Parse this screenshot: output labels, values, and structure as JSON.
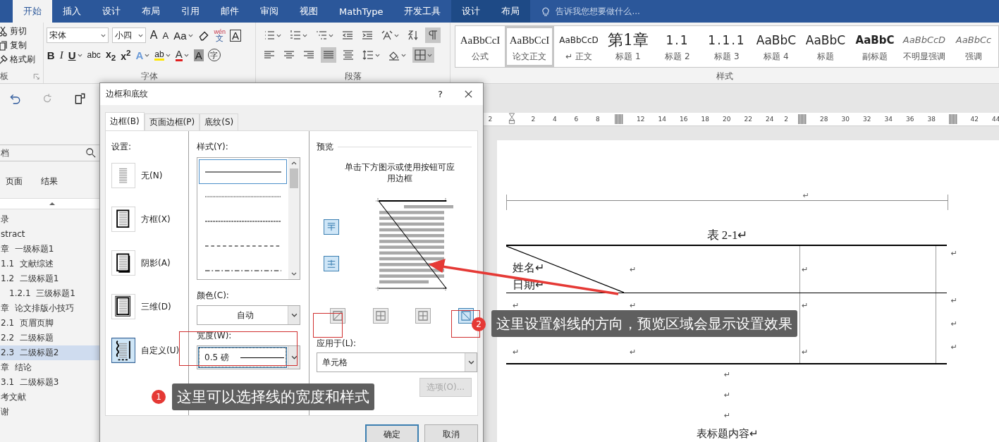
{
  "tabs": [
    {
      "label": "开始",
      "selected": true,
      "kind": "main"
    },
    {
      "label": "插入",
      "selected": false,
      "kind": "main"
    },
    {
      "label": "设计",
      "selected": false,
      "kind": "main"
    },
    {
      "label": "布局",
      "selected": false,
      "kind": "main"
    },
    {
      "label": "引用",
      "selected": false,
      "kind": "main"
    },
    {
      "label": "邮件",
      "selected": false,
      "kind": "main"
    },
    {
      "label": "审阅",
      "selected": false,
      "kind": "main"
    },
    {
      "label": "视图",
      "selected": false,
      "kind": "main"
    },
    {
      "label": "MathType",
      "selected": false,
      "kind": "main"
    },
    {
      "label": "开发工具",
      "selected": false,
      "kind": "main"
    },
    {
      "label": "设计",
      "selected": false,
      "kind": "context"
    },
    {
      "label": "布局",
      "selected": false,
      "kind": "context"
    }
  ],
  "tell_me": {
    "placeholder": "告诉我您想要做什么..."
  },
  "clipboard": {
    "items": [
      {
        "kind": "cut",
        "label": "剪切"
      },
      {
        "kind": "copy",
        "label": "复制"
      },
      {
        "kind": "brush",
        "label": "格式刷"
      }
    ],
    "label": "板"
  },
  "font": {
    "name": "宋体",
    "size": "小四",
    "label": "字体",
    "row1": [
      {
        "kind": "grow",
        "label": "A"
      },
      {
        "kind": "shrink",
        "label": "A"
      },
      {
        "kind": "case",
        "label": "Aa",
        "dropdown": true
      },
      {
        "kind": "clear"
      },
      {
        "kind": "phonetic",
        "top": "wén",
        "label": "文"
      },
      {
        "kind": "boxed",
        "label": "A"
      }
    ],
    "row2": [
      {
        "kind": "bold",
        "label": "B"
      },
      {
        "kind": "italic",
        "label": "I"
      },
      {
        "kind": "underline",
        "label": "U",
        "dropdown": true
      },
      {
        "kind": "strike",
        "label": "abc"
      },
      {
        "kind": "sub",
        "label": "x$_{2}$"
      },
      {
        "kind": "sup",
        "label": "x$^{2}$"
      },
      {
        "kind": "effects",
        "label": "A",
        "dropdown": true
      },
      {
        "kind": "highlight",
        "label": "ab",
        "dropdown": true
      },
      {
        "kind": "color",
        "label": "A",
        "dropdown": true
      },
      {
        "kind": "shade",
        "label": "A"
      },
      {
        "kind": "enclosed",
        "label": "字"
      }
    ]
  },
  "paragraph": {
    "label": "段落",
    "row1": [
      {
        "kind": "bullets",
        "on": false,
        "dropdown": true
      },
      {
        "kind": "numbering",
        "on": false,
        "dropdown": true
      },
      {
        "kind": "multilevel",
        "on": false,
        "dropdown": true
      },
      {
        "kind": "outdent",
        "on": false
      },
      {
        "kind": "indent",
        "on": false
      },
      {
        "kind": "asian",
        "on": false,
        "dropdown": true
      },
      {
        "kind": "sort",
        "on": false
      },
      {
        "kind": "marks",
        "on": true
      }
    ],
    "row2": [
      {
        "kind": "left",
        "on": false
      },
      {
        "kind": "center",
        "on": false
      },
      {
        "kind": "right",
        "on": false
      },
      {
        "kind": "justify",
        "on": true
      },
      {
        "kind": "distribute",
        "on": false
      },
      {
        "kind": "spacing",
        "on": false,
        "dropdown": true
      },
      {
        "kind": "shading",
        "on": false,
        "dropdown": true
      },
      {
        "kind": "borders",
        "on": true,
        "dropdown": true
      }
    ]
  },
  "styles": {
    "label": "样式",
    "items": [
      {
        "preview": "AaBbCcI",
        "name": "公式",
        "kind": "serif",
        "selected": false
      },
      {
        "preview": "AaBbCcI",
        "name": "论文正文",
        "kind": "serif",
        "selected": true
      },
      {
        "preview": "AaBbCcD",
        "name": "↵ 正文",
        "kind": "small",
        "selected": false
      },
      {
        "preview": "第1章",
        "name": "标题 1",
        "kind": "big",
        "selected": false
      },
      {
        "preview": "1.1",
        "name": "标题 2",
        "kind": "num",
        "selected": false
      },
      {
        "preview": "1.1.1",
        "name": "标题 3",
        "kind": "num",
        "selected": false
      },
      {
        "preview": "AaBbC",
        "name": "标题 4",
        "kind": "sans",
        "selected": false
      },
      {
        "preview": "AaBbC",
        "name": "标题",
        "kind": "sans-large",
        "selected": false
      },
      {
        "preview": "AaBbC",
        "name": "副标题",
        "kind": "sans-bold",
        "selected": false
      },
      {
        "preview": "AaBbCcD",
        "name": "不明显强调",
        "kind": "italic",
        "selected": false
      },
      {
        "preview": "AaBbCc",
        "name": "强调",
        "kind": "italic",
        "selected": false
      }
    ]
  },
  "nav": {
    "search": {
      "placeholder": "档"
    },
    "tabs": [
      {
        "label": "页面",
        "selected": false
      },
      {
        "label": "结果",
        "selected": false
      }
    ],
    "items": [
      {
        "label": "录",
        "selected": false
      },
      {
        "label": "stract",
        "selected": false
      },
      {
        "label": "章  一级标题1",
        "selected": false,
        "children": [
          {
            "label": "1.1  文献综述",
            "selected": false
          },
          {
            "label": "1.2  二级标题1",
            "selected": false,
            "children": [
              {
                "label": "1.2.1  三级标题1",
                "selected": false
              }
            ]
          }
        ]
      },
      {
        "label": "章  论文排版小技巧",
        "selected": false,
        "children": [
          {
            "label": "2.1  页眉页脚",
            "selected": false
          },
          {
            "label": "2.2  二级标题",
            "selected": false
          },
          {
            "label": "2.3  二级标题2",
            "selected": true
          }
        ]
      },
      {
        "label": "章  结论",
        "selected": false,
        "children": [
          {
            "label": "3.1  二级标题3",
            "selected": false
          }
        ]
      },
      {
        "label": "考文献",
        "selected": false
      },
      {
        "label": "谢",
        "selected": false
      }
    ]
  },
  "ruler": [
    {
      "kind": "num",
      "label": "2"
    },
    {
      "kind": "indent"
    },
    {
      "kind": "num",
      "label": "2"
    },
    {
      "kind": "num",
      "label": "4"
    },
    {
      "kind": "num",
      "label": "6"
    },
    {
      "kind": "num",
      "label": "8"
    },
    {
      "kind": "column"
    },
    {
      "kind": "num",
      "label": "12"
    },
    {
      "kind": "num",
      "label": "14"
    },
    {
      "kind": "num",
      "label": "16"
    },
    {
      "kind": "num",
      "label": "18"
    },
    {
      "kind": "num",
      "label": "20"
    },
    {
      "kind": "num",
      "label": "22"
    },
    {
      "kind": "num",
      "label": "24"
    },
    {
      "kind": "cut",
      "label": "2"
    },
    {
      "kind": "column"
    },
    {
      "kind": "num",
      "label": "28"
    },
    {
      "kind": "num",
      "label": "30"
    },
    {
      "kind": "num",
      "label": "32"
    },
    {
      "kind": "num",
      "label": "34"
    },
    {
      "kind": "num",
      "label": "36"
    },
    {
      "kind": "num",
      "label": "38"
    },
    {
      "kind": "column"
    },
    {
      "kind": "num",
      "label": "42"
    },
    {
      "kind": "num",
      "label": "44"
    }
  ],
  "document": {
    "header_mark": "↵",
    "caption": "表 2-1↵",
    "table": {
      "rows": [
        {
          "kind": "diagonal",
          "cells": [
            [
              "姓名↵",
              "日期↵"
            ],
            [
              "↵"
            ],
            [
              "↵"
            ]
          ],
          "end": "↵"
        },
        {
          "kind": "plain",
          "cells": [
            [
              "↵"
            ],
            [
              "↵"
            ],
            [
              "↵"
            ]
          ],
          "end": "↵"
        },
        {
          "kind": "plain",
          "end": "↵"
        },
        {
          "kind": "plain",
          "cells": [
            [
              "↵"
            ],
            [
              "↵"
            ],
            [
              "↵"
            ]
          ],
          "end": "↵"
        }
      ]
    },
    "paragraphs": [
      "↵",
      "↵",
      "↵",
      "表标题内容↵"
    ]
  },
  "dialog": {
    "title": "边框和底纹",
    "help": "?",
    "tabs": [
      {
        "label": "边框(B)",
        "selected": true
      },
      {
        "label": "页面边框(P)",
        "selected": false
      },
      {
        "label": "底纹(S)",
        "selected": false
      }
    ],
    "settings": {
      "label": "设置:",
      "items": [
        {
          "label": "无(N)",
          "kind": "none",
          "selected": false
        },
        {
          "label": "方框(X)",
          "kind": "box",
          "selected": false
        },
        {
          "label": "阴影(A)",
          "kind": "shadow",
          "selected": false
        },
        {
          "label": "三维(D)",
          "kind": "threed",
          "selected": false
        },
        {
          "label": "自定义(U)",
          "kind": "custom",
          "selected": true
        }
      ]
    },
    "style": {
      "label": "样式(Y):",
      "lines": [
        {
          "kind": "solid",
          "selected": true
        },
        {
          "kind": "dotted",
          "selected": false
        },
        {
          "kind": "dashed",
          "selected": false
        },
        {
          "kind": "dash",
          "selected": false
        },
        {
          "kind": "dashdot",
          "selected": false
        }
      ]
    },
    "color": {
      "label": "颜色(C):",
      "value": "自动"
    },
    "width": {
      "label": "宽度(W):",
      "value": "0.5 磅"
    },
    "preview": {
      "label": "预览",
      "hint": "单击下方图示或使用按钮可应用边框",
      "side_buttons": [
        {
          "kind": "top",
          "on": true
        },
        {
          "kind": "bottom",
          "on": true
        }
      ],
      "bottom_buttons": [
        {
          "kind": "diag_up",
          "on": false
        },
        {
          "kind": "inside_h",
          "on": false
        },
        {
          "kind": "inside_v",
          "on": false
        },
        {
          "kind": "diag_down",
          "on": true
        }
      ]
    },
    "apply_to": {
      "label": "应用于(L):",
      "value": "单元格"
    },
    "options": {
      "label": "选项(O)...",
      "disabled": true
    },
    "ok": "确定",
    "cancel": "取消"
  },
  "callouts": [
    {
      "number": "1",
      "text": "这里可以选择线的宽度和样式"
    },
    {
      "number": "2",
      "text": "这里设置斜线的方向，预览区域会显示设置效果"
    }
  ]
}
